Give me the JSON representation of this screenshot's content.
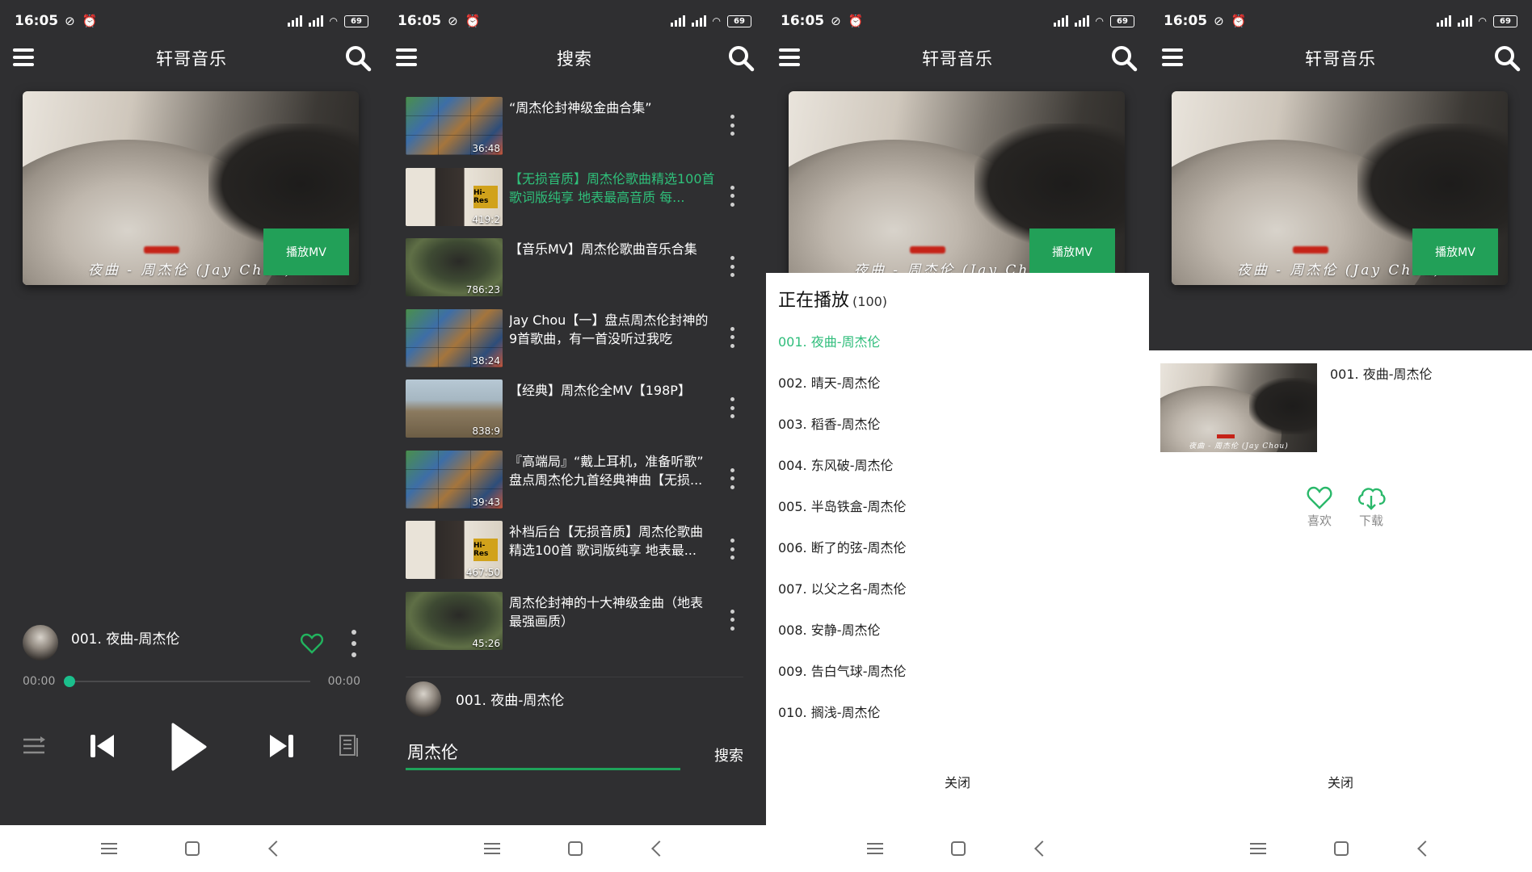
{
  "status": {
    "time": "16:05",
    "battery": "69"
  },
  "panel1": {
    "title": "轩哥音乐",
    "cover_caption": "夜曲 - 周杰伦 (Jay Chou)",
    "mv_button": "播放MV",
    "now_playing": "001. 夜曲-周杰伦",
    "time_current": "00:00",
    "time_total": "00:00"
  },
  "panel2": {
    "title": "搜索",
    "results": [
      {
        "title": "“周杰伦封神级金曲合集”",
        "duration": "36:48",
        "active": false,
        "thumb": "grid"
      },
      {
        "title": "【无损音质】周杰伦歌曲精选100首 歌词版纯享 地表最高音质 每...",
        "duration": "419:2",
        "active": true,
        "thumb": "face"
      },
      {
        "title": "【音乐MV】周杰伦歌曲音乐合集",
        "duration": "786:23",
        "active": false,
        "thumb": "army"
      },
      {
        "title": "Jay Chou【一】盘点周杰伦封神的9首歌曲，有一首没听过我吃",
        "duration": "38:24",
        "active": false,
        "thumb": "grid"
      },
      {
        "title": "【经典】周杰伦全MV【198P】",
        "duration": "838:9",
        "active": false,
        "thumb": "castle"
      },
      {
        "title": "『高端局』“戴上耳机，准备听歌” 盘点周杰伦九首经典神曲【无损...",
        "duration": "39:43",
        "active": false,
        "thumb": "grid"
      },
      {
        "title": "补档后台【无损音质】周杰伦歌曲精选100首 歌词版纯享 地表最...",
        "duration": "467:50",
        "active": false,
        "thumb": "face"
      },
      {
        "title": "周杰伦封神的十大神级金曲（地表最强画质）",
        "duration": "45:26",
        "active": false,
        "thumb": "army"
      }
    ],
    "now_playing": "001. 夜曲-周杰伦",
    "search_value": "周杰伦",
    "search_button": "搜索"
  },
  "panel3": {
    "title": "轩哥音乐",
    "mv_button": "播放MV",
    "cover_caption": "夜曲 - 周杰伦 (Jay Chou)",
    "sheet_title": "正在播放",
    "sheet_count": "(100)",
    "tracks": [
      {
        "label": "001. 夜曲-周杰伦",
        "active": true
      },
      {
        "label": "002. 晴天-周杰伦",
        "active": false
      },
      {
        "label": "003. 稻香-周杰伦",
        "active": false
      },
      {
        "label": "004. 东风破-周杰伦",
        "active": false
      },
      {
        "label": "005. 半岛铁盒-周杰伦",
        "active": false
      },
      {
        "label": "006. 断了的弦-周杰伦",
        "active": false
      },
      {
        "label": "007. 以父之名-周杰伦",
        "active": false
      },
      {
        "label": "008. 安静-周杰伦",
        "active": false
      },
      {
        "label": "009. 告白气球-周杰伦",
        "active": false
      },
      {
        "label": "010. 搁浅-周杰伦",
        "active": false
      }
    ],
    "close": "关闭"
  },
  "panel4": {
    "title": "轩哥音乐",
    "mv_button": "播放MV",
    "cover_caption": "夜曲 - 周杰伦 (Jay Chou)",
    "detail_caption": "夜曲 - 周杰伦 (Jay Chou)",
    "detail_title": "001. 夜曲-周杰伦",
    "like_label": "喜欢",
    "download_label": "下载",
    "close": "关闭"
  },
  "colors": {
    "accent": "#22a058",
    "active_text": "#2fbd7b",
    "background": "#2f2f31",
    "seek_knob": "#1bbf8c"
  }
}
